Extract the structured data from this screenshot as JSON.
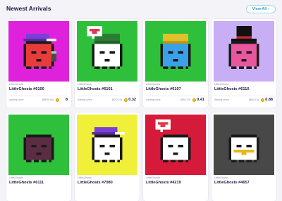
{
  "header": {
    "title": "Newest Arrivals",
    "view_all_label": "View All",
    "view_all_icon": "chevron-right-icon"
  },
  "colors": {
    "accent": "#2aa6bd",
    "coin": "#f4c317"
  },
  "cards": [
    {
      "collection": "LittleGhosts",
      "name": "LittleGhosts #6100",
      "asking_label": "Asking price",
      "usd": "($509.68)",
      "price": "8",
      "bg": "#e021dc",
      "ghost": "#e83b3b",
      "hat": "cap-purple",
      "accessory": "phone"
    },
    {
      "collection": "LittleGhosts",
      "name": "LittleGhosts #6101",
      "asking_label": "Asking price",
      "usd": "($20.23)",
      "price": "0.32",
      "bg": "#2ec03a",
      "ghost": "#ffffff",
      "hat": "beanie-green",
      "accessory": "heart-bubble"
    },
    {
      "collection": "LittleGhosts",
      "name": "LittleGhosts #6107",
      "asking_label": "Asking price",
      "usd": "($26.13)",
      "price": "0.41",
      "bg": "#2ec03a",
      "ghost": "#3aa0e8",
      "hat": "beanie-yellow",
      "accessory": "none"
    },
    {
      "collection": "LittleGhosts",
      "name": "LittleGhosts #6110",
      "asking_label": "Asking price",
      "usd": "($56.13)",
      "price": "0.88",
      "bg": "#c7aef5",
      "ghost": "#e8579d",
      "hat": "tophat-black",
      "accessory": "none"
    },
    {
      "collection": "LittleGhosts",
      "name": "LittleGhosts #6111",
      "asking_label": "",
      "usd": "",
      "price": "",
      "bg": "#2ec03a",
      "ghost": "#5a2d44",
      "hat": "none",
      "accessory": "none"
    },
    {
      "collection": "LittleGhosts",
      "name": "LittleGhosts #7080",
      "asking_label": "",
      "usd": "",
      "price": "",
      "bg": "#f0ef3a",
      "ghost": "#ffffff",
      "hat": "cap-purple",
      "accessory": "none"
    },
    {
      "collection": "LittleGhosts",
      "name": "LittleGhosts #4219",
      "asking_label": "",
      "usd": "",
      "price": "",
      "bg": "#d61a3a",
      "ghost": "#ffffff",
      "hat": "none",
      "accessory": "heart-bubble"
    },
    {
      "collection": "LittleGhosts",
      "name": "LittleGhosts #4657",
      "asking_label": "",
      "usd": "",
      "price": "",
      "bg": "#484848",
      "ghost": "#ffffff",
      "hat": "none",
      "accessory": "gold-chain"
    }
  ]
}
